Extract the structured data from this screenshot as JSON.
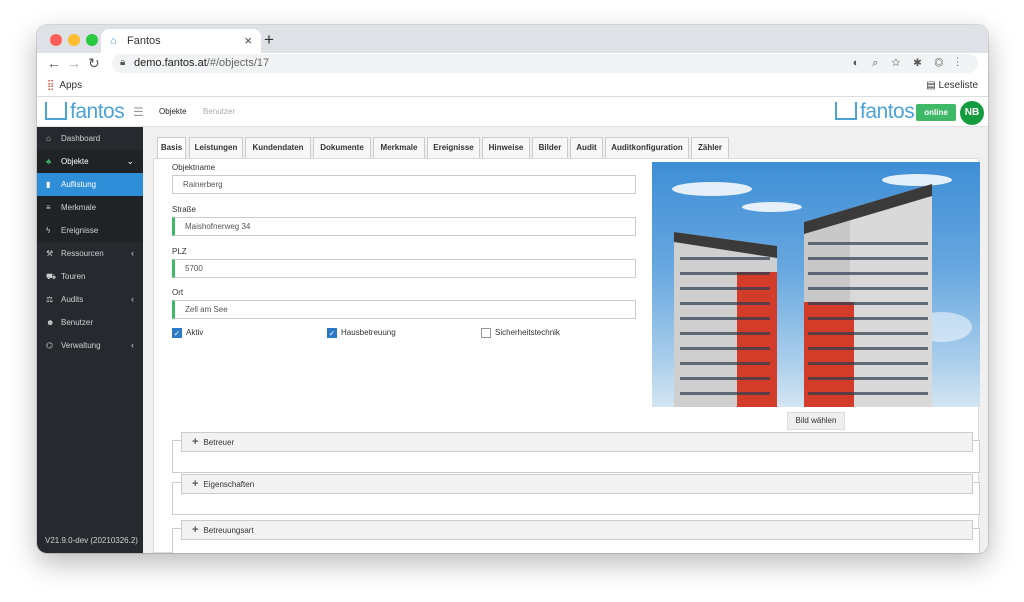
{
  "browser": {
    "tab_title": "Fantos",
    "url_host": "demo.fantos.at",
    "url_path": "/#/objects/17",
    "apps_label": "Apps",
    "reading_list_label": "Leseliste"
  },
  "header": {
    "logo_text": "fantos",
    "nav": [
      "Objekte",
      "Benutzer"
    ],
    "status": "online",
    "avatar": "NB"
  },
  "sidebar": {
    "items": [
      {
        "label": "Dashboard",
        "icon": "dashboard-icon",
        "glyph": "⌂"
      },
      {
        "label": "Objekte",
        "icon": "leaf-icon",
        "glyph": "♣",
        "chevron": "⌄"
      },
      {
        "label": "Auflistung",
        "icon": "document-icon",
        "glyph": "▮"
      },
      {
        "label": "Merkmale",
        "icon": "list-icon",
        "glyph": "≡"
      },
      {
        "label": "Ereignisse",
        "icon": "bolt-icon",
        "glyph": "ϟ"
      },
      {
        "label": "Ressourcen",
        "icon": "wrench-icon",
        "glyph": "⚒",
        "chevron": "‹"
      },
      {
        "label": "Touren",
        "icon": "car-icon",
        "glyph": "⛟"
      },
      {
        "label": "Audits",
        "icon": "gavel-icon",
        "glyph": "⚖",
        "chevron": "‹"
      },
      {
        "label": "Benutzer",
        "icon": "users-icon",
        "glyph": "☻"
      },
      {
        "label": "Verwaltung",
        "icon": "bank-icon",
        "glyph": "⌬",
        "chevron": "‹"
      }
    ],
    "version": "V21.9.0-dev (20210326.2)"
  },
  "tabs": [
    "Basis",
    "Leistungen",
    "Kundendaten",
    "Dokumente",
    "Merkmale",
    "Ereignisse",
    "Hinweise",
    "Bilder",
    "Audit",
    "Auditkonfiguration",
    "Zähler"
  ],
  "form": {
    "objektname_label": "Objektname",
    "objektname_value": "Rainerberg",
    "strasse_label": "Straße",
    "strasse_value": "Maishofnerweg 34",
    "plz_label": "PLZ",
    "plz_value": "5700",
    "ort_label": "Ort",
    "ort_value": "Zell am See",
    "checkboxes": [
      {
        "label": "Aktiv",
        "checked": true
      },
      {
        "label": "Hausbetreuung",
        "checked": true
      },
      {
        "label": "Sicherheitstechnik",
        "checked": false
      }
    ]
  },
  "image_button": "Bild wählen",
  "sections": [
    "Betreuer",
    "Eigenschaften",
    "Betreuungsart"
  ],
  "colors": {
    "accent": "#2f8ed8",
    "sidebar": "#262a2e",
    "online": "#3fb868",
    "avatar": "#159b3f",
    "logo": "#4ba3d6"
  }
}
